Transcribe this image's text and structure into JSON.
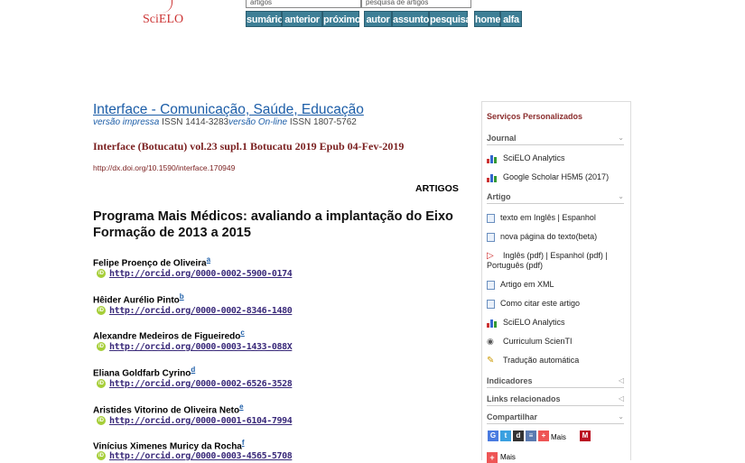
{
  "top": {
    "logo": "SciELO",
    "field_left": "artigos",
    "field_right": "pesquisa de artigos",
    "nav": [
      "sumário",
      "anterior",
      "próximo",
      "autor",
      "assunto",
      "pesquisa",
      "home",
      "alfa"
    ]
  },
  "journal": {
    "title": "Interface - Comunicação, Saúde, Educação",
    "print_label": "versão impressa",
    "print_issn": "ISSN 1414-3283",
    "online_label": "versão On-line",
    "online_issn": "ISSN 1807-5762",
    "issue": "Interface (Botucatu) vol.23  supl.1 Botucatu  2019  Epub 04-Fev-2019",
    "doi": "http://dx.doi.org/10.1590/interface.170949",
    "section": "ARTIGOS"
  },
  "article": {
    "title": "Programa Mais Médicos: avaliando a implantação do Eixo Formação de 2013 a 2015",
    "authors": [
      {
        "name": "Felipe Proenço de Oliveira",
        "sup": "a",
        "orcid": "http://orcid.org/0000-0002-5900-0174"
      },
      {
        "name": "Hêider Aurélio Pinto",
        "sup": "b",
        "orcid": "http://orcid.org/0000-0002-8346-1480"
      },
      {
        "name": "Alexandre Medeiros de Figueiredo",
        "sup": "c",
        "orcid": "http://orcid.org/0000-0003-1433-088X"
      },
      {
        "name": "Eliana Goldfarb Cyrino",
        "sup": "d",
        "orcid": "http://orcid.org/0000-0002-6526-3528"
      },
      {
        "name": "Aristides Vitorino de Oliveira Neto",
        "sup": "e",
        "orcid": "http://orcid.org/0000-0001-6104-7994"
      },
      {
        "name": "Vinícius Ximenes Muricy da Rocha",
        "sup": "f",
        "orcid": "http://orcid.org/0000-0003-4565-5708"
      }
    ]
  },
  "sidebar": {
    "heading": "Serviços Personalizados",
    "journal_label": "Journal",
    "journal_items": [
      "SciELO Analytics",
      "Google Scholar H5M5 (2017)"
    ],
    "artigo_label": "Artigo",
    "artigo_items": [
      "texto em Inglês | Espanhol",
      "nova página do texto(beta)",
      "Inglês (pdf) | Espanhol (pdf) | Português (pdf)",
      "Artigo em XML",
      "Como citar este artigo",
      "SciELO Analytics",
      "Curriculum ScienTI",
      "Tradução automática"
    ],
    "indicadores": "Indicadores",
    "links": "Links relacionados",
    "compartilhar": "Compartilhar",
    "mais": "Mais",
    "mais2": "Mais"
  },
  "colors": {
    "link": "#1d5ea8",
    "issue": "#7a1f1f",
    "nav": "#3e7f96",
    "sidebar_heading": "#8b2d2d"
  }
}
